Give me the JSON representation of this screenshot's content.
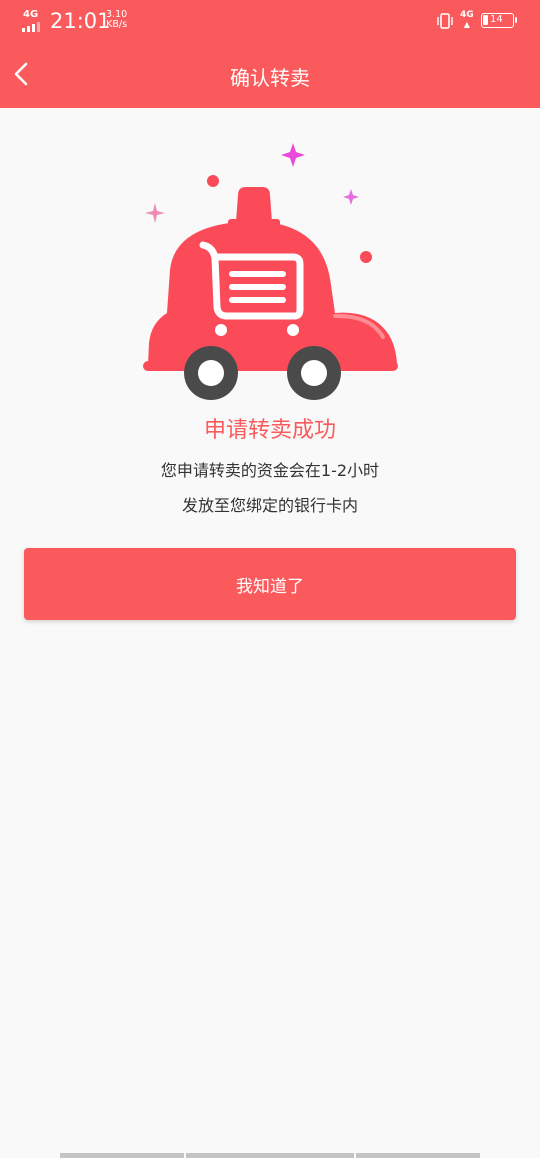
{
  "status_bar": {
    "network_left": "4G",
    "time": "21:01",
    "speed_value": "3.10",
    "speed_unit": "KB/s",
    "network_right": "4G",
    "battery_level": "14"
  },
  "nav": {
    "back_icon": "chevron-left-icon",
    "title": "确认转卖"
  },
  "illustration": {
    "icon": "shopping-cart-car-icon",
    "primary_color": "#fb4b58",
    "wheel_color": "#4a4a4a",
    "sparkle_colors": [
      "#e94ad9",
      "#f08bb7",
      "#e46fdf"
    ]
  },
  "result": {
    "title": "申请转卖成功",
    "line1": "您申请转卖的资金会在1-2小时",
    "line2": "发放至您绑定的银行卡内"
  },
  "actions": {
    "confirm_label": "我知道了"
  },
  "colors": {
    "accent": "#fb5a5c",
    "background": "#f9f9f9"
  }
}
